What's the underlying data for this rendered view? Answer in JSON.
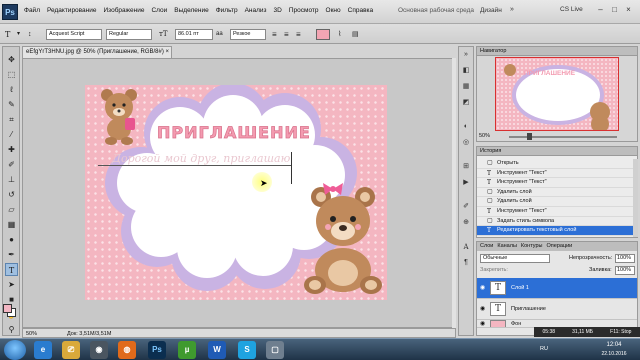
{
  "menu": {
    "logo": "Ps",
    "items": [
      "Файл",
      "Редактирование",
      "Изображение",
      "Слои",
      "Выделение",
      "Фильтр",
      "Анализ",
      "3D",
      "Просмотр",
      "Окно",
      "Справка"
    ],
    "workspace_title": "Основная рабочая среда",
    "workspace_design": "Дизайн",
    "cs_live": "CS Live"
  },
  "options": {
    "font_family": "Acquest Script",
    "font_style": "Regular",
    "font_size": "86.01 пт",
    "antialias": "Резкое",
    "text_color": "#f3a5b3"
  },
  "document": {
    "tab_title": "eEfgYrT3HNU.jpg @ 50% (Приглашение, RGB/8#) ×",
    "zoom": "50%",
    "doc_info": "Док: 3,51M/3,51M",
    "invite_title": "ПРИГЛАШЕНИЕ",
    "subtitle": "Дорогой мой друг, приглашаю",
    "canvas_colors": {
      "pink": "#f4b6c1",
      "lilac": "#c9b3e3",
      "title": "#f39bb0"
    }
  },
  "navigator": {
    "tab": "Навигатор",
    "zoom": "50%",
    "thumb_title": "ПРИГЛАШЕНИЕ"
  },
  "history": {
    "tab": "История",
    "items": [
      "Открыть",
      "Инструмент \"Текст\"",
      "Инструмент \"Текст\"",
      "Удалить слой",
      "Удалить слой",
      "Инструмент \"Текст\"",
      "Задать стиль символа",
      "Редактировать текстовый слой"
    ]
  },
  "layers": {
    "tabs": [
      "Слои",
      "Каналы",
      "Контуры",
      "Операции"
    ],
    "blend_mode": "Обычные",
    "opacity_label": "Непрозрачность:",
    "opacity_value": "100%",
    "lock_label": "Закрепить:",
    "fill_label": "Заливка:",
    "fill_value": "100%",
    "items": [
      {
        "name": "Слой 1",
        "thumb": "T"
      },
      {
        "name": "Приглашение",
        "thumb": "T"
      },
      {
        "name": "Фон",
        "thumb": ""
      }
    ]
  },
  "mini_status": [
    "05:38",
    "31,11 МБ",
    "F11: Stop"
  ],
  "taskbar": {
    "apps": [
      "e",
      "⎚",
      "◉",
      "Ps",
      "µ",
      "W",
      "S",
      "▢"
    ],
    "lang": "RU",
    "time": "12:04",
    "date": "22.10.2016"
  }
}
